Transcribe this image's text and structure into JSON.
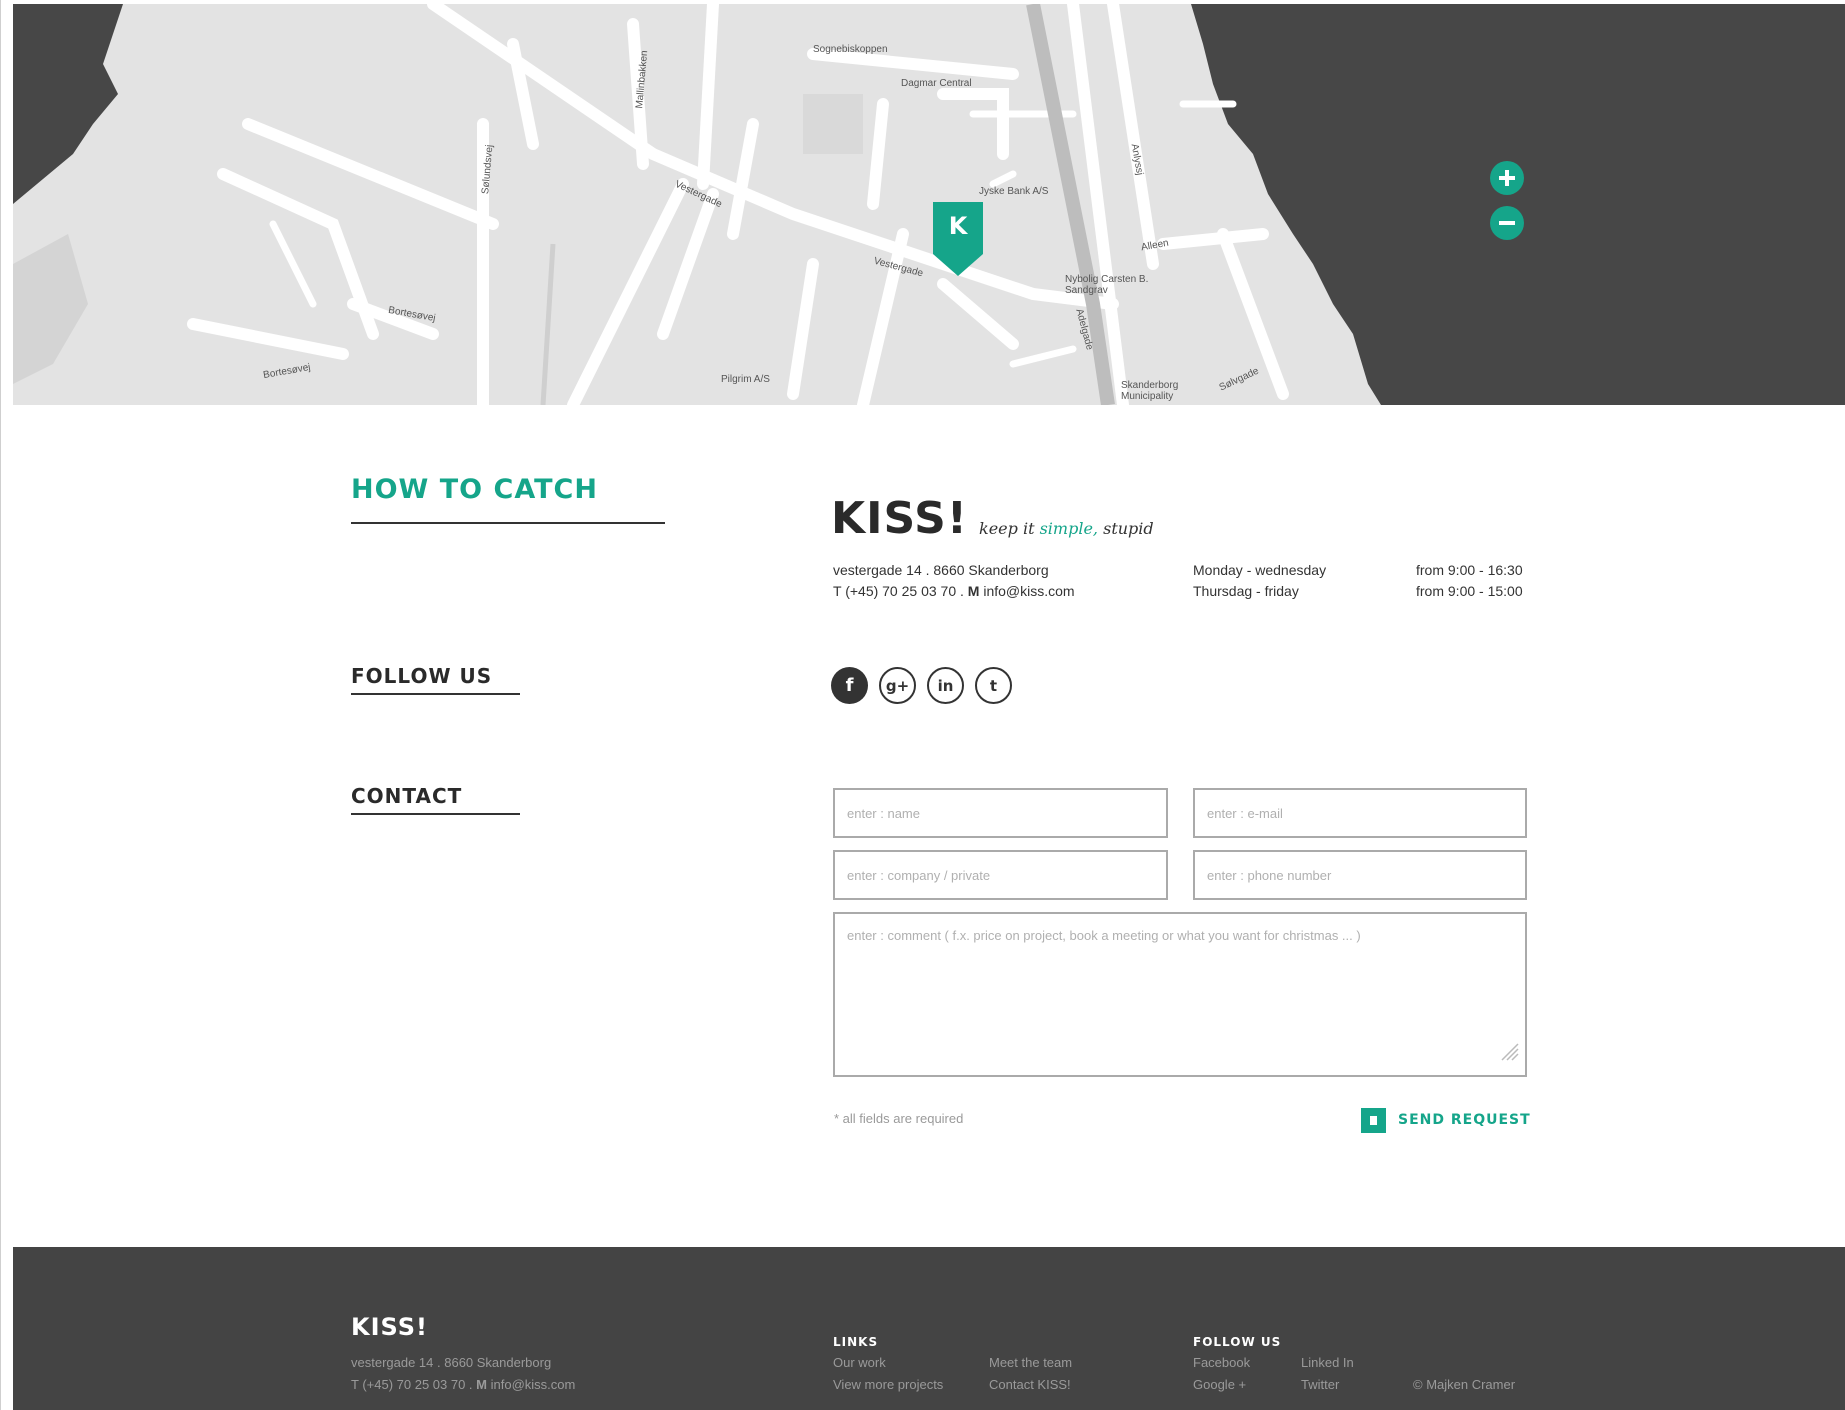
{
  "map": {
    "marker_letter": "K",
    "zoom_in_label": "+",
    "zoom_out_label": "−",
    "street_labels": [
      "Vestergade",
      "Vestergade",
      "Sølundsvej",
      "Bortesøvej",
      "Bortesøvej",
      "Adelgade",
      "Anlyssj",
      "Alleen",
      "Jyske Bank A/S",
      "Dagmar Central",
      "Nybolig Carsten B. Sandgrav",
      "Skanderborg Municipality",
      "Pilgrim A/S",
      "Sølvgade",
      "Sognebiskoppen",
      "Mallinbakken"
    ]
  },
  "sections": {
    "how_to_catch": "HOW TO CATCH",
    "follow_us": "FOLLOW US",
    "contact": "CONTACT"
  },
  "brand": {
    "logo": "KISS!",
    "tagline_pre": "keep it ",
    "tagline_accent": "simple,",
    "tagline_post": " stupid"
  },
  "contact_info": {
    "address": "vestergade 14 . 8660 Skanderborg",
    "phone_line_prefix": "T (+45) 70 25 03 70 . ",
    "mail_marker": "M",
    "email": "info@kiss.com",
    "hours": [
      {
        "days": "Monday - wednesday",
        "time": "from 9:00 - 16:30"
      },
      {
        "days": "Thursdag - friday",
        "time": "from 9:00 - 15:00"
      }
    ]
  },
  "social": {
    "facebook": "f",
    "google": "g+",
    "linkedin": "in",
    "twitter": "t"
  },
  "form": {
    "name_placeholder": "enter : name",
    "email_placeholder": "enter : e-mail",
    "company_placeholder": "enter : company / private",
    "phone_placeholder": "enter : phone number",
    "comment_placeholder": "enter : comment ( f.x. price on project, book a meeting or what you want for christmas ... )",
    "required_note": "* all fields are required",
    "send_label": "SEND REQUEST"
  },
  "footer": {
    "logo": "KISS!",
    "address": "vestergade 14 . 8660 Skanderborg",
    "phone_line_prefix": "T (+45) 70 25 03 70 . ",
    "mail_marker": "M",
    "email": "info@kiss.com",
    "links_heading": "LINKS",
    "links": [
      "Our work",
      "Meet the team",
      "View more projects",
      "Contact KISS!"
    ],
    "follow_heading": "FOLLOW US",
    "follow_links": [
      "Facebook",
      "Linked In",
      "Google +",
      "Twitter"
    ],
    "copyright": "© Majken Cramer"
  },
  "colors": {
    "accent": "#15a58a",
    "dark": "#444444",
    "map_land": "#e3e3e3",
    "map_water": "#474747"
  }
}
